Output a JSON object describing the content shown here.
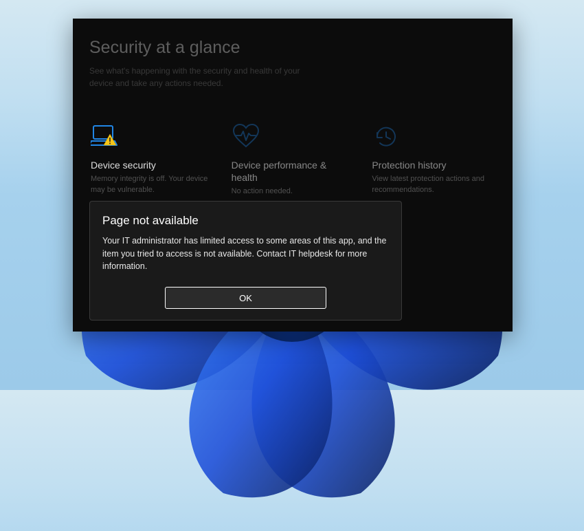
{
  "header": {
    "title": "Security at a glance",
    "subtitle": "See what's happening with the security and health of your device and take any actions needed."
  },
  "cards": [
    {
      "title": "Device security",
      "desc": "Memory integrity is off. Your device may be vulnerable.",
      "icon": "device-security",
      "status": "warning",
      "highlighted": true
    },
    {
      "title": "Device performance & health",
      "desc": "No action needed.",
      "icon": "performance-health",
      "status": "ok"
    },
    {
      "title": "Protection history",
      "desc": "View latest protection actions and recommendations.",
      "icon": "protection-history",
      "status": "none"
    }
  ],
  "dialog": {
    "title": "Page not available",
    "body": "Your IT administrator has limited access to some areas of this app, and the item you tried to access is not available. Contact IT helpdesk for more information.",
    "ok_label": "OK"
  }
}
